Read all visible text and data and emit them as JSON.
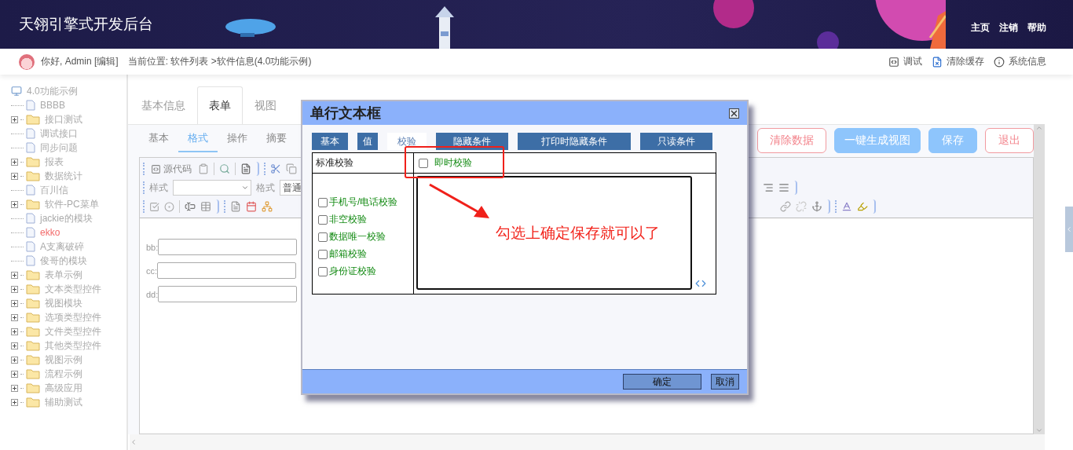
{
  "header": {
    "title": "天翎引擎式开发后台",
    "links": [
      "主页",
      "注销",
      "帮助"
    ]
  },
  "info_bar": {
    "greeting": "你好, Admin [编辑]",
    "breadcrumb": "当前位置: 软件列表 >软件信息(4.0功能示例)",
    "actions": [
      {
        "kind": "debug",
        "label": "调试"
      },
      {
        "kind": "clear",
        "label": "清除缓存"
      },
      {
        "kind": "info",
        "label": "系统信息"
      }
    ]
  },
  "tree": {
    "root": "4.0功能示例",
    "children": [
      {
        "label": "BBBB",
        "kind": "page",
        "selected": false
      },
      {
        "label": "接口测试",
        "kind": "folder",
        "expanded": false,
        "selected": false
      },
      {
        "label": "调试接口",
        "kind": "page",
        "selected": false
      },
      {
        "label": "同步问题",
        "kind": "page",
        "selected": false
      },
      {
        "label": "报表",
        "kind": "folder",
        "expanded": false,
        "selected": false
      },
      {
        "label": "数据统计",
        "kind": "folder",
        "expanded": false,
        "selected": false
      },
      {
        "label": "百川信",
        "kind": "page",
        "selected": false
      },
      {
        "label": "软件-PC菜单",
        "kind": "folder",
        "expanded": false,
        "selected": false
      },
      {
        "label": "jackie的模块",
        "kind": "page",
        "selected": false
      },
      {
        "label": "ekko",
        "kind": "page",
        "selected": true
      },
      {
        "label": "A支离破碎",
        "kind": "page",
        "selected": false
      },
      {
        "label": "俊哥的模块",
        "kind": "page",
        "selected": false
      },
      {
        "label": "表单示例",
        "kind": "folder",
        "expanded": false,
        "selected": false
      },
      {
        "label": "文本类型控件",
        "kind": "folder",
        "expanded": false,
        "selected": false
      },
      {
        "label": "视图模块",
        "kind": "folder",
        "expanded": false,
        "selected": false
      },
      {
        "label": "选项类型控件",
        "kind": "folder",
        "expanded": false,
        "selected": false
      },
      {
        "label": "文件类型控件",
        "kind": "folder",
        "expanded": false,
        "selected": false
      },
      {
        "label": "其他类型控件",
        "kind": "folder",
        "expanded": false,
        "selected": false
      },
      {
        "label": "视图示例",
        "kind": "folder",
        "expanded": false,
        "selected": false
      },
      {
        "label": "流程示例",
        "kind": "folder",
        "expanded": false,
        "selected": false
      },
      {
        "label": "高级应用",
        "kind": "folder",
        "expanded": false,
        "selected": false
      },
      {
        "label": "辅助测试",
        "kind": "folder",
        "expanded": false,
        "selected": false
      }
    ]
  },
  "main_tabs": [
    {
      "label": "基本信息",
      "selected": false
    },
    {
      "label": "表单",
      "selected": true
    },
    {
      "label": "视图",
      "selected": false
    }
  ],
  "sub_tabs": [
    {
      "label": "基本",
      "selected": false
    },
    {
      "label": "格式",
      "selected": true
    },
    {
      "label": "操作",
      "selected": false
    },
    {
      "label": "摘要",
      "selected": false
    }
  ],
  "action_buttons": [
    {
      "label": "清除数据",
      "kind": "outline"
    },
    {
      "label": "一键生成视图",
      "kind": "primary"
    },
    {
      "label": "保存",
      "kind": "primary"
    },
    {
      "label": "退出",
      "kind": "outline"
    }
  ],
  "editor_toolbar": {
    "source_label": "源代码",
    "style_label": "样式",
    "format_label": "格式",
    "format_value": "普通"
  },
  "form_fields": [
    {
      "label": "bb:"
    },
    {
      "label": "cc:"
    },
    {
      "label": "dd:"
    }
  ],
  "dialog": {
    "title": "单行文本框",
    "tabs": [
      {
        "label": "基本",
        "selected": false
      },
      {
        "label": "值",
        "selected": false
      },
      {
        "label": "校验",
        "selected": true
      },
      {
        "label": "隐藏条件",
        "selected": false
      },
      {
        "label": "打印时隐藏条件",
        "selected": false
      },
      {
        "label": "只读条件",
        "selected": false
      }
    ],
    "standard_label": "标准校验",
    "instant_check": {
      "label": "即时校验",
      "checked": false
    },
    "checks": [
      {
        "label": "手机号/电话校验",
        "checked": false
      },
      {
        "label": "非空校验",
        "checked": false
      },
      {
        "label": "数据唯一校验",
        "checked": false
      },
      {
        "label": "邮箱校验",
        "checked": false
      },
      {
        "label": "身份证校验",
        "checked": false
      }
    ],
    "note": "勾选上确定保存就可以了",
    "buttons": [
      {
        "label": "确定",
        "kind": "wide"
      },
      {
        "label": "取消",
        "kind": "narrow"
      }
    ]
  }
}
